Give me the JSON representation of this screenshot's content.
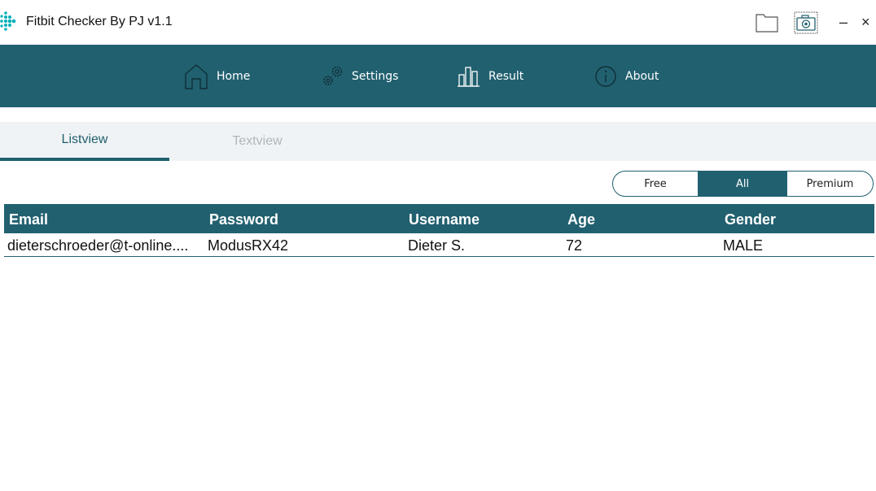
{
  "window": {
    "title": "Fitbit Checker By PJ v1.1",
    "minimize_glyph": "–",
    "close_glyph": "×",
    "icons": [
      "fitbit-logo",
      "folder-icon",
      "camera-icon"
    ]
  },
  "nav": {
    "items": [
      {
        "label": "Home",
        "icon": "home-icon"
      },
      {
        "label": "Settings",
        "icon": "gears-icon"
      },
      {
        "label": "Result",
        "icon": "bar-chart-icon"
      },
      {
        "label": "About",
        "icon": "info-icon"
      }
    ]
  },
  "tabs": [
    {
      "label": "Listview",
      "active": true
    },
    {
      "label": "Textview",
      "active": false
    }
  ],
  "filter": {
    "options": [
      "Free",
      "All",
      "Premium"
    ],
    "selected": "All"
  },
  "table": {
    "headers": [
      "Email",
      "Password",
      "Username",
      "Age",
      "Gender"
    ],
    "rows": [
      [
        "dieterschroeder@t-online....",
        "ModusRX42",
        "Dieter S.",
        "72",
        "MALE"
      ]
    ]
  },
  "colors": {
    "accent": "#21606f",
    "logo": "#00b0b9",
    "tab_bg": "#f0f3f5",
    "inactive_tab_text": "#aeb7bc"
  }
}
